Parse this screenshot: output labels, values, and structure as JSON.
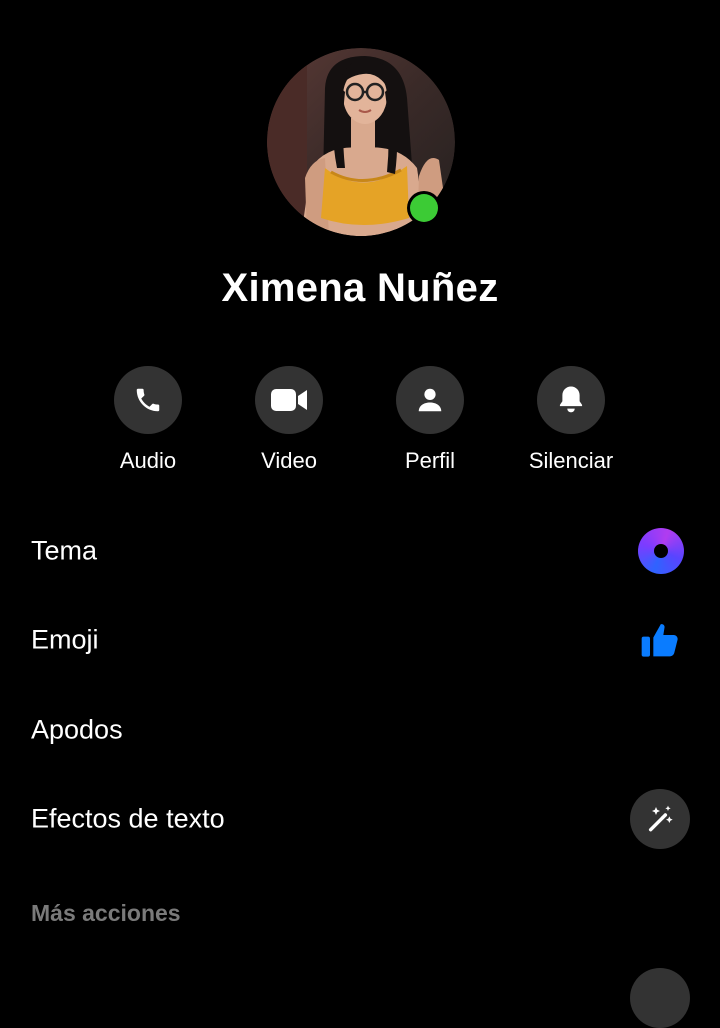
{
  "contact": {
    "name": "Ximena Nuñez",
    "online": true,
    "presence_color": "#3ccb35"
  },
  "actions": [
    {
      "id": "audio",
      "label": "Audio",
      "icon": "phone-icon"
    },
    {
      "id": "video",
      "label": "Video",
      "icon": "video-camera-icon"
    },
    {
      "id": "profile",
      "label": "Perfil",
      "icon": "person-icon"
    },
    {
      "id": "mute",
      "label": "Silenciar",
      "icon": "bell-icon"
    }
  ],
  "settings": [
    {
      "id": "theme",
      "label": "Tema",
      "icon": "theme-ring-icon"
    },
    {
      "id": "emoji",
      "label": "Emoji",
      "icon": "thumbs-up-icon"
    },
    {
      "id": "nicknames",
      "label": "Apodos",
      "icon": ""
    },
    {
      "id": "text_effects",
      "label": "Efectos de texto",
      "icon": "magic-wand-icon"
    }
  ],
  "more_actions": {
    "title": "Más acciones"
  },
  "colors": {
    "background": "#000000",
    "button_bg": "#333333",
    "accent_blue": "#0a7cff",
    "muted_text": "#7a7a7a"
  }
}
